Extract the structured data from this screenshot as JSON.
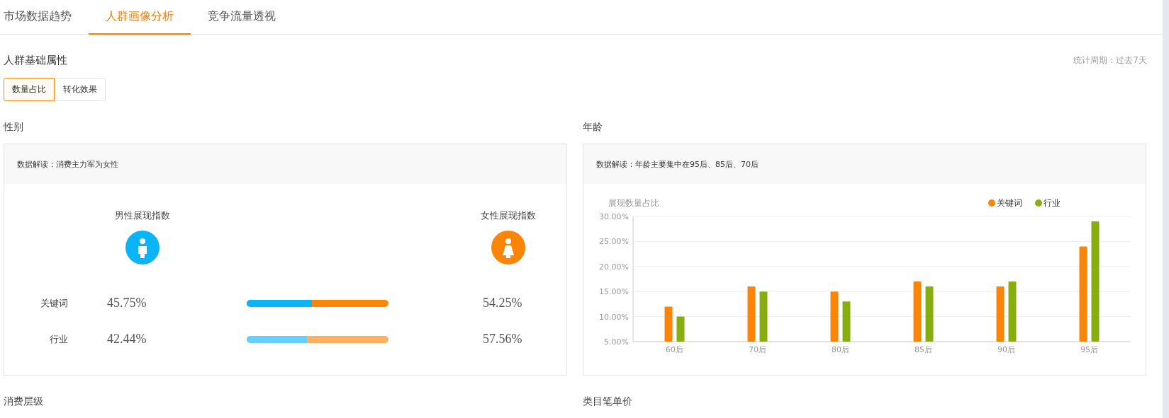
{
  "tabs": [
    {
      "label": "市场数据趋势",
      "selected": false
    },
    {
      "label": "人群画像分析",
      "selected": true
    },
    {
      "label": "竞争流量透视",
      "selected": false
    }
  ],
  "section": {
    "title": "人群基础属性",
    "period": "统计周期：过去7天"
  },
  "toggle": [
    {
      "label": "数量占比",
      "selected": true
    },
    {
      "label": "转化效果",
      "selected": false
    }
  ],
  "gender": {
    "title": "性别",
    "insight": "数据解读：消费主力军为女性",
    "male_label": "男性展现指数",
    "female_label": "女性展现指数",
    "rows": [
      {
        "label": "关键词",
        "male": "45.75%",
        "female": "54.25%",
        "level": 0.4575,
        "kind": "primary"
      },
      {
        "label": "行业",
        "male": "42.44%",
        "female": "57.56%",
        "level": 0.4244,
        "kind": "secondary"
      }
    ]
  },
  "age": {
    "title": "年龄",
    "insight": "数据解读：年龄主要集中在95后、85后、70后",
    "chart_data": {
      "type": "bar",
      "ylabel": "展现数量占比",
      "categories": [
        "60后",
        "70后",
        "80后",
        "85后",
        "90后",
        "95后"
      ],
      "series": [
        {
          "name": "关键词",
          "color": "#fa8508",
          "values": [
            12,
            16,
            15,
            17,
            16,
            24
          ]
        },
        {
          "name": "行业",
          "color": "#88ad0e",
          "values": [
            10,
            15,
            13,
            16,
            17,
            29
          ]
        }
      ],
      "ylim": [
        5,
        30
      ],
      "grid": true,
      "legend": "top-right",
      "yticks": [
        {
          "value": 5,
          "label": "5.00%"
        },
        {
          "value": 10,
          "label": "10.00%"
        },
        {
          "value": 15,
          "label": "15.00%"
        },
        {
          "value": 20,
          "label": "20.00%"
        },
        {
          "value": 25,
          "label": "25.00%"
        },
        {
          "value": 30,
          "label": "30.00%"
        }
      ]
    }
  },
  "bottom": [
    "消费层级",
    "类目笔单价"
  ]
}
